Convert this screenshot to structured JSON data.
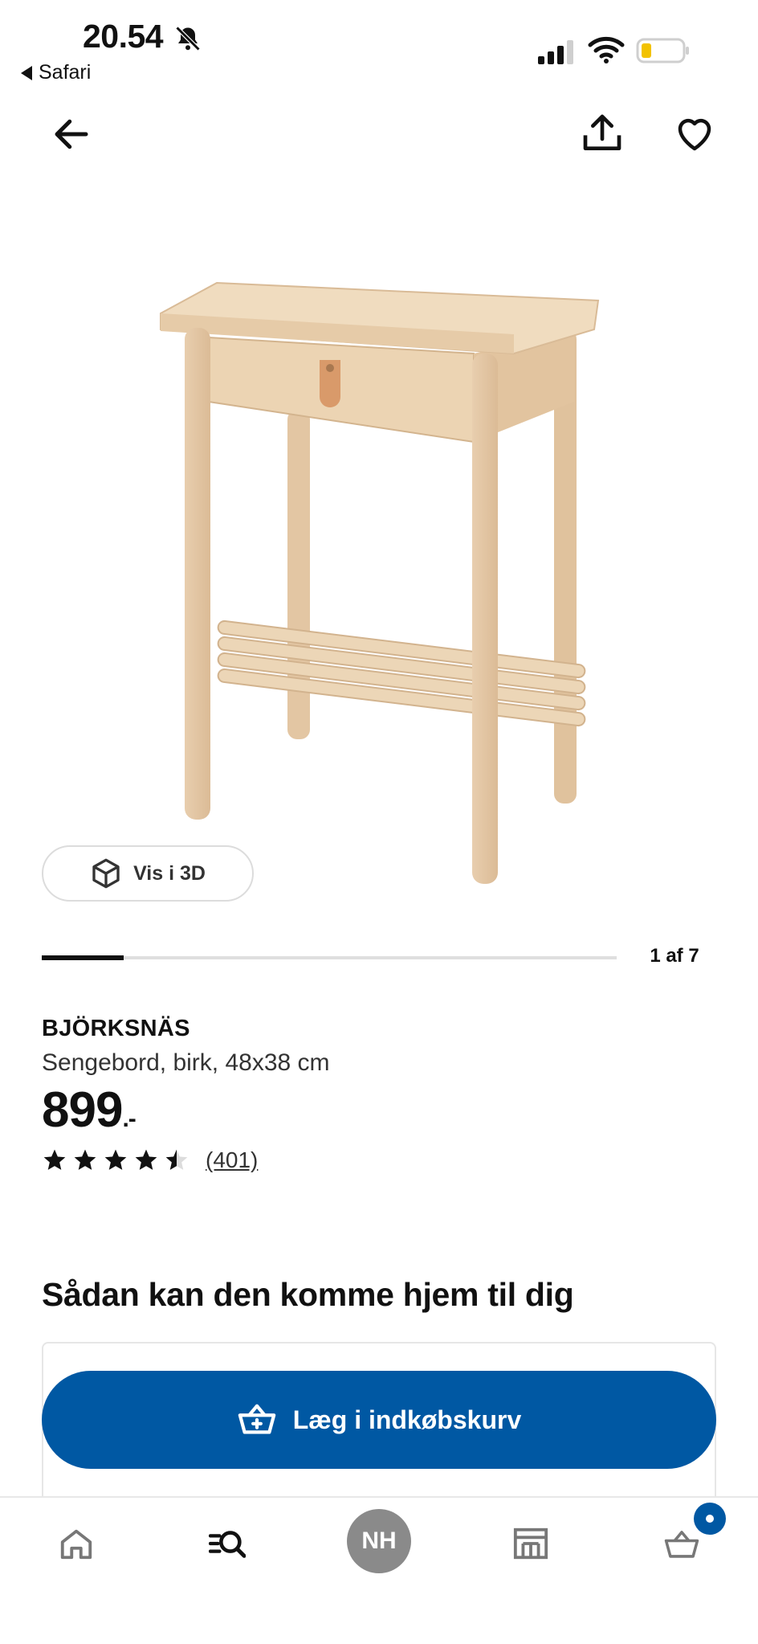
{
  "status_bar": {
    "time": "20.54",
    "back_app": "Safari",
    "icons": [
      "bell-slash-icon",
      "signal-icon",
      "wifi-icon",
      "battery-icon"
    ]
  },
  "nav": {
    "icons": [
      "back-arrow-icon",
      "share-icon",
      "heart-icon"
    ]
  },
  "gallery": {
    "view_3d_label": "Vis i 3D",
    "counter": "1 af 7",
    "current": 1,
    "total": 7
  },
  "product": {
    "name": "BJÖRKSNÄS",
    "description": "Sengebord, birk, 48x38 cm",
    "price": "899",
    "price_suffix": ".-",
    "rating": 4.5,
    "rating_max": 5,
    "review_count": "(401)"
  },
  "delivery": {
    "heading": "Sådan kan den komme hjem til dig"
  },
  "cta": {
    "add_to_cart": "Læg i indkøbskurv"
  },
  "tabbar": {
    "items": [
      {
        "name": "home",
        "icon": "home-icon"
      },
      {
        "name": "search",
        "icon": "search-list-icon"
      },
      {
        "name": "profile",
        "label": "NH"
      },
      {
        "name": "stores",
        "icon": "store-icon"
      },
      {
        "name": "cart",
        "icon": "basket-icon"
      }
    ]
  },
  "colors": {
    "primary": "#0058a3",
    "text": "#111111",
    "avatar": "#8a8a8a"
  }
}
